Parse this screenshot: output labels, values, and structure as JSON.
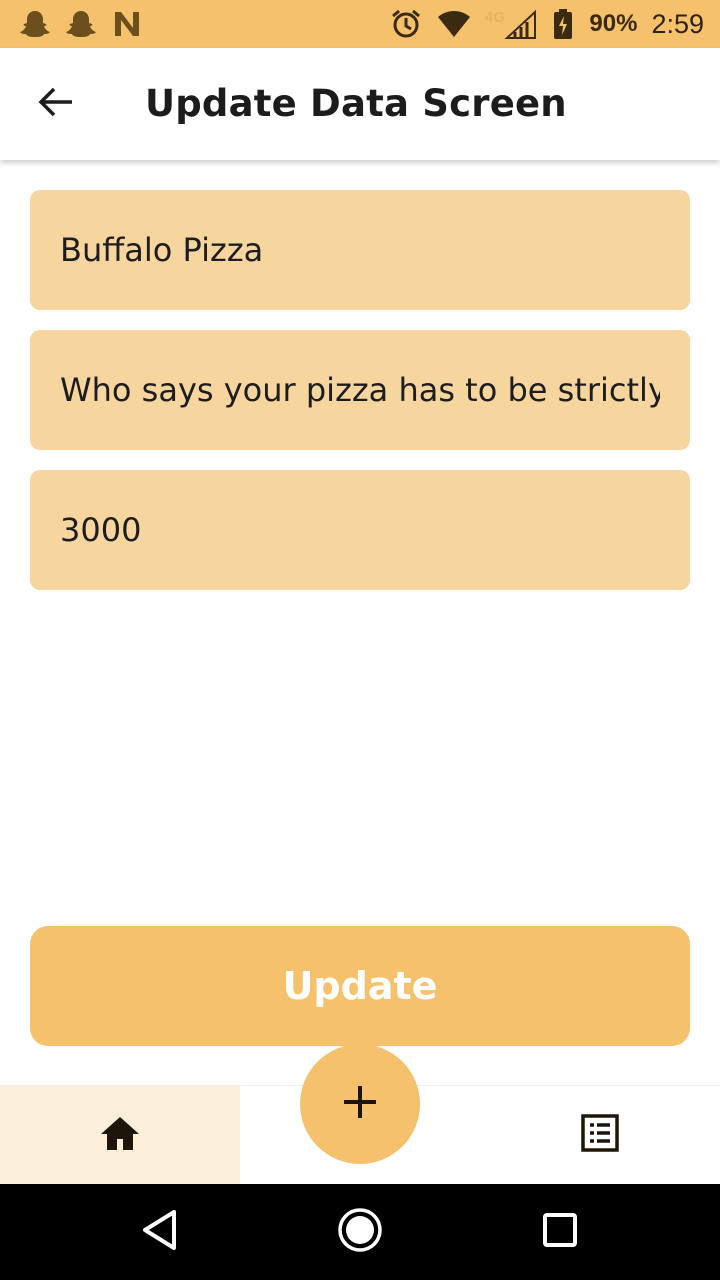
{
  "status_bar": {
    "left_icons": [
      "snapchat-icon",
      "snapchat-icon",
      "n-app-icon"
    ],
    "right_icons": [
      "alarm-icon",
      "wifi-icon",
      "lte-signal-icon",
      "battery-icon"
    ],
    "network_label": "4G",
    "battery_percent": "90%",
    "time": "2:59",
    "color": "#f5c16c"
  },
  "app_bar": {
    "back_icon": "arrow-left-icon",
    "title": "Update Data Screen"
  },
  "form": {
    "name_value": "Buffalo Pizza",
    "description_value": "Who says your pizza has to be strictly to",
    "price_value": "3000"
  },
  "update_button": {
    "label": "Update"
  },
  "bottom_nav": {
    "home_icon": "home-icon",
    "fab_icon": "plus-icon",
    "list_icon": "list-icon"
  },
  "system_nav": {
    "back_icon": "triangle-back-icon",
    "home_icon": "circle-home-icon",
    "recent_icon": "square-recent-icon"
  },
  "colors": {
    "accent": "#f5c16c",
    "field_bg": "#f7d59f",
    "home_tab_bg": "#fcefd9"
  }
}
